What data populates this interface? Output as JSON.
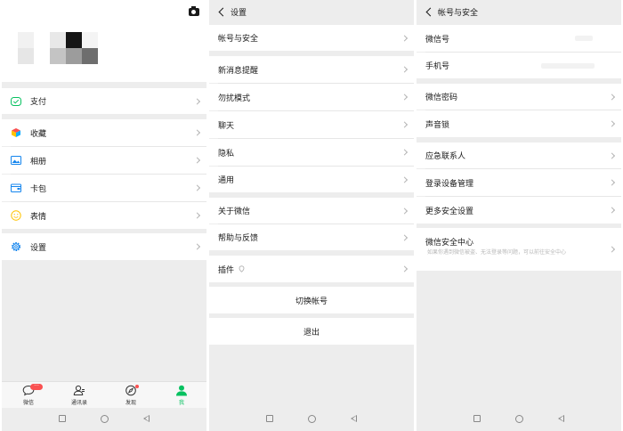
{
  "panel_me": {
    "menu": [
      {
        "label": "支付",
        "icon": "wechat-pay-icon"
      },
      {
        "label": "收藏",
        "icon": "favorites-cube-icon"
      },
      {
        "label": "相册",
        "icon": "album-image-icon"
      },
      {
        "label": "卡包",
        "icon": "card-wallet-icon"
      },
      {
        "label": "表情",
        "icon": "smiley-face-icon"
      },
      {
        "label": "设置",
        "icon": "gear-icon"
      }
    ],
    "tabs": [
      {
        "label": "微信",
        "icon": "chat-bubble-icon",
        "badge": "···"
      },
      {
        "label": "通讯录",
        "icon": "contacts-icon"
      },
      {
        "label": "发现",
        "icon": "compass-icon"
      },
      {
        "label": "我",
        "icon": "person-icon",
        "active": true
      }
    ],
    "active_color": "#07c160"
  },
  "panel_settings": {
    "title": "设置",
    "items": [
      "帐号与安全",
      "新消息提醒",
      "勿扰模式",
      "聊天",
      "隐私",
      "通用",
      "关于微信",
      "帮助与反馈",
      "插件"
    ],
    "switch_account": "切换帐号",
    "logout": "退出"
  },
  "panel_account": {
    "title": "帐号与安全",
    "items": [
      "微信号",
      "手机号",
      "微信密码",
      "声音锁",
      "应急联系人",
      "登录设备管理",
      "更多安全设置",
      "微信安全中心"
    ],
    "security_center_note": "如果你遇到微信被盗、无法登录等问题，可以前往安全中心"
  }
}
